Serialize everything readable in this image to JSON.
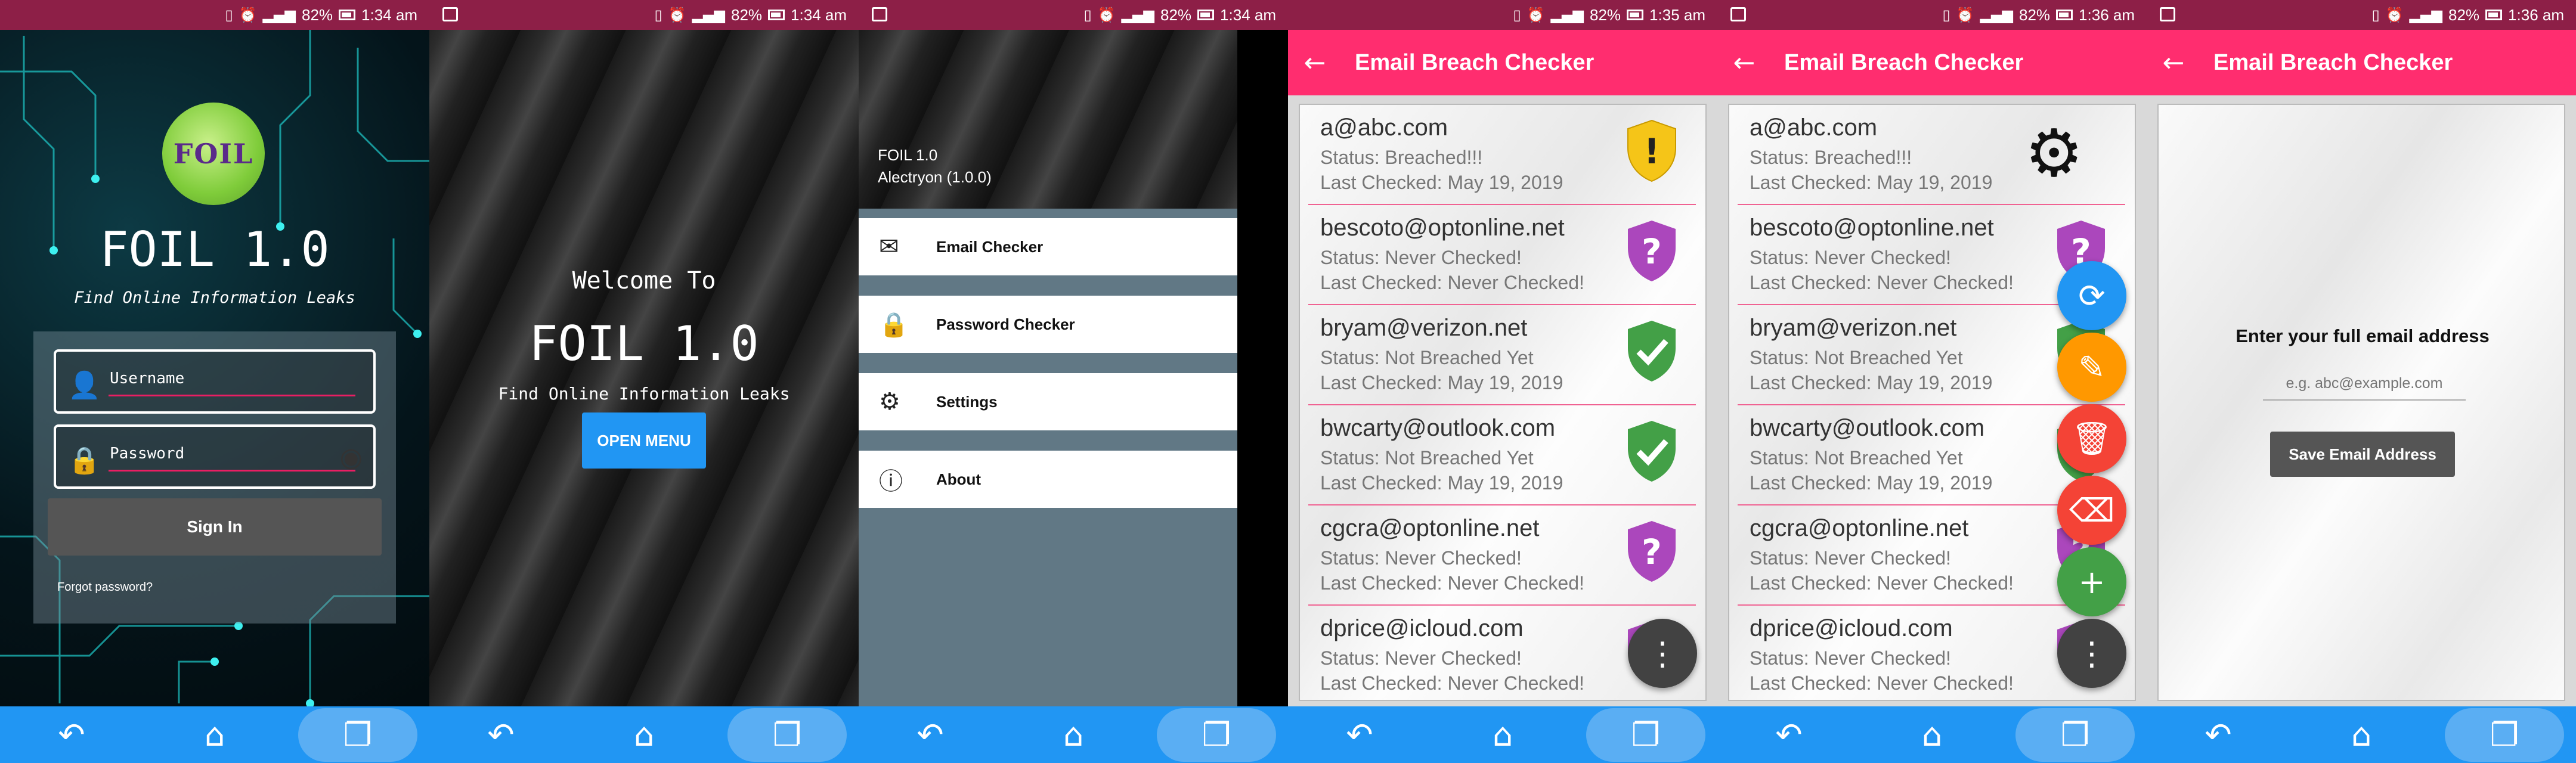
{
  "status_bar": {
    "battery": "82%",
    "times": [
      "1:34 am",
      "1:34 am",
      "1:34 am",
      "1:35 am",
      "1:36 am",
      "1:36 am"
    ]
  },
  "app": {
    "name": "FOIL 1.0",
    "tagline": "Find Online Information Leaks",
    "logo_text": "FOIL"
  },
  "login": {
    "username_placeholder": "Username",
    "password_placeholder": "Password",
    "sign_in": "Sign In",
    "forgot": "Forgot password?"
  },
  "welcome": {
    "line1": "Welcome To",
    "title": "FOIL 1.0",
    "tagline": "Find Online Information Leaks",
    "button": "OPEN MENU"
  },
  "drawer": {
    "header_title": "FOIL 1.0",
    "header_sub": "Alectryon (1.0.0)",
    "items": [
      {
        "label": "Email Checker",
        "icon": "email-shield-icon"
      },
      {
        "label": "Password Checker",
        "icon": "lock-icon"
      },
      {
        "label": "Settings",
        "icon": "gear-icon"
      },
      {
        "label": "About",
        "icon": "info-icon"
      }
    ]
  },
  "checker": {
    "title": "Email Breach Checker",
    "emails": [
      {
        "email": "a@abc.com",
        "status": "Status: Breached!!!",
        "checked": "Last Checked: May 19, 2019",
        "state": "breached"
      },
      {
        "email": "bescoto@optonline.net",
        "status": "Status: Never Checked!",
        "checked": "Last Checked: Never Checked!",
        "state": "unknown"
      },
      {
        "email": "bryam@verizon.net",
        "status": "Status: Not Breached Yet",
        "checked": "Last Checked: May 19, 2019",
        "state": "safe"
      },
      {
        "email": "bwcarty@outlook.com",
        "status": "Status: Not Breached Yet",
        "checked": "Last Checked: May 19, 2019",
        "state": "safe"
      },
      {
        "email": "cgcra@optonline.net",
        "status": "Status: Never Checked!",
        "checked": "Last Checked: Never Checked!",
        "state": "unknown"
      },
      {
        "email": "dprice@icloud.com",
        "status": "Status: Never Checked!",
        "checked": "Last Checked: Never Checked!",
        "state": "unknown"
      }
    ],
    "colors": {
      "breached": "#f5c518",
      "unknown": "#ab47bc",
      "safe": "#43a047",
      "accent": "#ff2d6f"
    }
  },
  "add_email": {
    "label": "Enter your full email address",
    "placeholder": "e.g. abc@example.com",
    "button": "Save Email Address"
  }
}
